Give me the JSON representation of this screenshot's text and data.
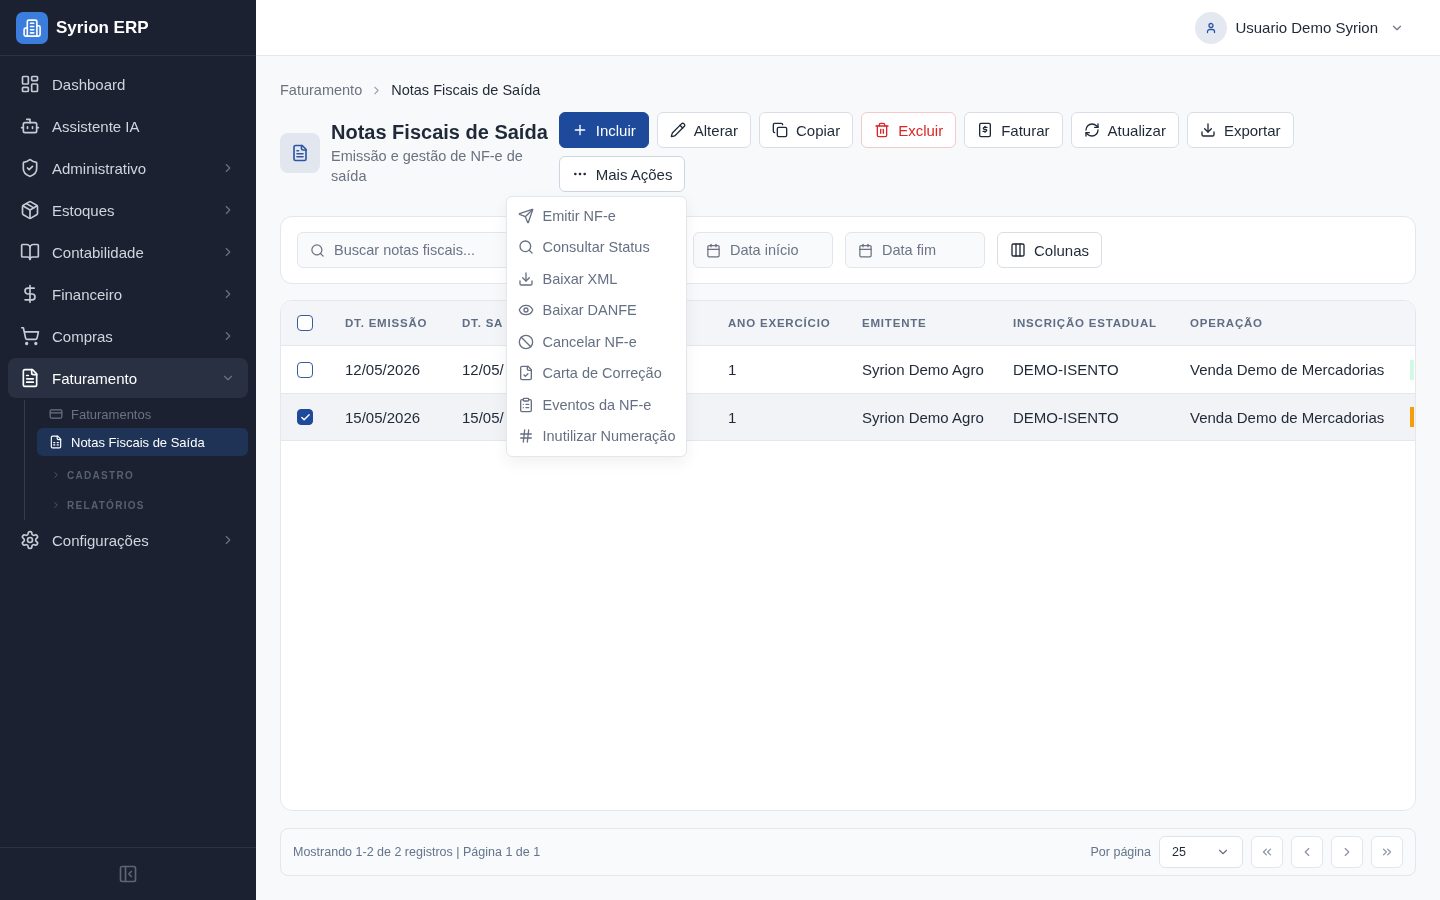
{
  "sidebar": {
    "brand": "Syrion ERP",
    "items": [
      {
        "label": "Dashboard",
        "kind": "link",
        "selected": false
      },
      {
        "label": "Assistente IA",
        "kind": "link",
        "selected": false
      },
      {
        "label": "Administrativo",
        "kind": "group",
        "selected": false,
        "expanded": false
      },
      {
        "label": "Estoques",
        "kind": "group",
        "selected": false,
        "expanded": false
      },
      {
        "label": "Contabilidade",
        "kind": "group",
        "selected": false,
        "expanded": false
      },
      {
        "label": "Financeiro",
        "kind": "group",
        "selected": false,
        "expanded": false
      },
      {
        "label": "Compras",
        "kind": "group",
        "selected": false,
        "expanded": false
      },
      {
        "label": "Faturamento",
        "kind": "group",
        "selected": true,
        "expanded": true,
        "children": [
          {
            "label": "Faturamentos",
            "kind": "link",
            "selected": false
          },
          {
            "label": "Notas Fiscais de Saída",
            "kind": "link",
            "selected": true
          },
          {
            "label": "CADASTRO",
            "kind": "section",
            "expanded": false
          },
          {
            "label": "RELATÓRIOS",
            "kind": "section",
            "expanded": false
          }
        ]
      },
      {
        "label": "Configurações",
        "kind": "group",
        "selected": false,
        "expanded": false
      }
    ]
  },
  "topbar": {
    "user_name": "Usuario Demo Syrion"
  },
  "breadcrumb": [
    "Faturamento",
    "Notas Fiscais de Saída"
  ],
  "page": {
    "title": "Notas Fiscais de Saída",
    "subtitle": "Emissão e gestão de NF-e de saída"
  },
  "toolbar": [
    {
      "label": "Incluir",
      "kind": "primary"
    },
    {
      "label": "Alterar",
      "kind": "default"
    },
    {
      "label": "Copiar",
      "kind": "default"
    },
    {
      "label": "Excluir",
      "kind": "danger"
    },
    {
      "label": "Faturar",
      "kind": "default"
    },
    {
      "label": "Atualizar",
      "kind": "default"
    },
    {
      "label": "Exportar",
      "kind": "default"
    },
    {
      "label": "Mais Ações",
      "kind": "menu",
      "expanded": true,
      "items": [
        "Emitir NF-e",
        "Consultar Status",
        "Baixar XML",
        "Baixar DANFE",
        "Cancelar NF-e",
        "Carta de Correção",
        "Eventos da NF-e",
        "Inutilizar Numeração"
      ]
    }
  ],
  "filters": {
    "search": {
      "placeholder": "Buscar notas fiscais..."
    },
    "date_start": {
      "placeholder": "Data início"
    },
    "date_end": {
      "placeholder": "Data fim"
    },
    "columns_button": "Colunas"
  },
  "table": {
    "select_all": {
      "checked": false
    },
    "header": {
      "dt_emissao": "DT. EMISSÃO",
      "column_2": "DT. SA",
      "ano_exercicio": "ANO EXERCÍCIO",
      "emitente": "EMITENTE",
      "inscricao_estadual": "INSCRIÇÃO ESTADUAL",
      "operacao": "OPERAÇÃO"
    },
    "rows": [
      {
        "selected": false,
        "color": "#d1fae5",
        "dt_emissao": "12/05/2026",
        "column_2": "12/05/",
        "ano_exercicio": "1",
        "emitente": "Syrion Demo Agro",
        "inscricao_estadual": "DEMO-ISENTO",
        "operacao": "Venda Demo de Mercadorias"
      },
      {
        "selected": true,
        "color": "#f59e0b",
        "dt_emissao": "15/05/2026",
        "column_2": "15/05/",
        "ano_exercicio": "1",
        "emitente": "Syrion Demo Agro",
        "inscricao_estadual": "DEMO-ISENTO",
        "operacao": "Venda Demo de Mercadorias"
      }
    ]
  },
  "pagination": {
    "summary": "Mostrando 1-2 de 2 registros | Página 1 de 1",
    "per_page_label": "Por página",
    "per_page": "25"
  }
}
